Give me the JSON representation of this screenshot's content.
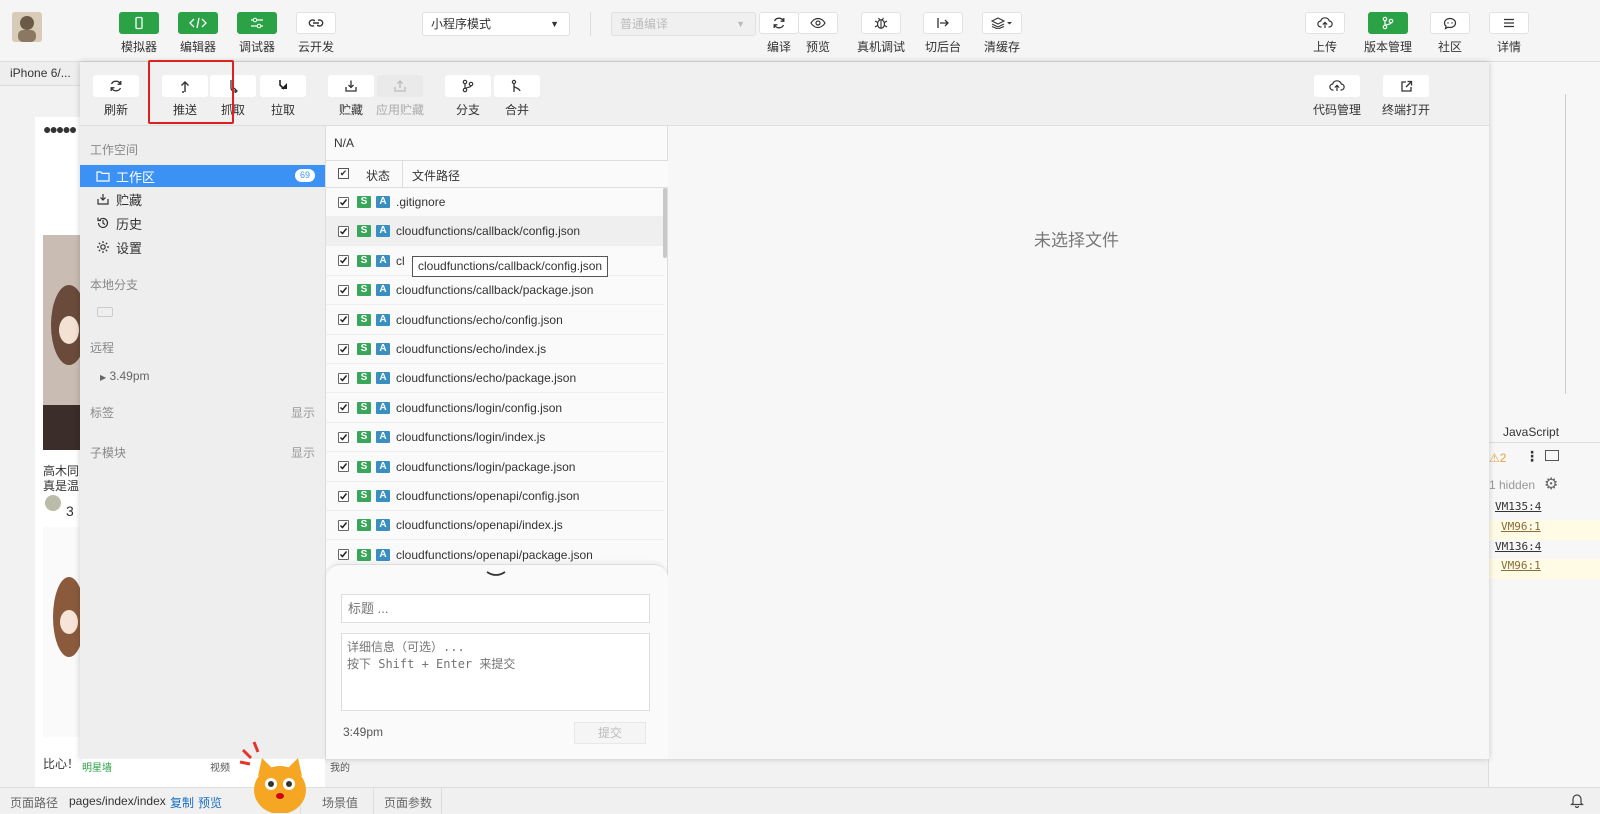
{
  "toolbar": {
    "left": [
      {
        "label": "模拟器",
        "icon": "phone-icon"
      },
      {
        "label": "编辑器",
        "icon": "code-icon"
      },
      {
        "label": "调试器",
        "icon": "sliders-icon"
      },
      {
        "label": "云开发",
        "icon": "cloud-link-icon"
      }
    ],
    "mode_select": "小程序模式",
    "compile_select": "普通编译",
    "mid": [
      {
        "label": "编译",
        "icon": "refresh-icon"
      },
      {
        "label": "预览",
        "icon": "eye-icon"
      },
      {
        "label": "真机调试",
        "icon": "bug-icon"
      },
      {
        "label": "切后台",
        "icon": "switch-icon"
      },
      {
        "label": "清缓存",
        "icon": "layers-icon"
      }
    ],
    "right": [
      {
        "label": "上传",
        "icon": "upload-cloud-icon"
      },
      {
        "label": "版本管理",
        "icon": "branch-icon"
      },
      {
        "label": "社区",
        "icon": "chat-icon"
      },
      {
        "label": "详情",
        "icon": "menu-icon"
      }
    ]
  },
  "device_label": "iPhone 6/...",
  "vcs": {
    "actions": [
      {
        "label": "刷新",
        "icon": "refresh-icon"
      },
      {
        "label": "推送",
        "icon": "push-icon"
      },
      {
        "label": "抓取",
        "icon": "fetch-icon"
      },
      {
        "label": "拉取",
        "icon": "pull-icon"
      },
      {
        "label": "贮藏",
        "icon": "stash-icon"
      },
      {
        "label": "应用贮藏",
        "icon": "apply-stash-icon"
      },
      {
        "label": "分支",
        "icon": "branch-icon"
      },
      {
        "label": "合并",
        "icon": "merge-icon"
      }
    ],
    "right_actions": [
      {
        "label": "代码管理",
        "icon": "cloud-code-icon"
      },
      {
        "label": "终端打开",
        "icon": "external-icon"
      }
    ],
    "sidebar": {
      "workspace_title": "工作空间",
      "items": [
        {
          "label": "工作区",
          "count": "69"
        },
        {
          "label": "贮藏"
        },
        {
          "label": "历史"
        },
        {
          "label": "设置"
        }
      ],
      "local_branch_title": "本地分支",
      "remote_title": "远程",
      "remote_item": "3.49pm",
      "tags_title": "标签",
      "tags_show": "显示",
      "submodule_title": "子模块",
      "submodule_show": "显示"
    },
    "files": {
      "branch": "N/A",
      "col_status": "状态",
      "col_path": "文件路径",
      "rows": [
        ".gitignore",
        "cloudfunctions/callback/config.json",
        "cl",
        "cloudfunctions/callback/package.json",
        "cloudfunctions/echo/config.json",
        "cloudfunctions/echo/index.js",
        "cloudfunctions/echo/package.json",
        "cloudfunctions/login/config.json",
        "cloudfunctions/login/index.js",
        "cloudfunctions/login/package.json",
        "cloudfunctions/openapi/config.json",
        "cloudfunctions/openapi/index.js",
        "cloudfunctions/openapi/package.json"
      ],
      "tooltip": "cloudfunctions/callback/config.json"
    },
    "commit": {
      "title_placeholder": "标题 ...",
      "detail_placeholder": "详细信息（可选）...\n按下 Shift + Enter 来提交",
      "time": "3:49pm",
      "submit": "提交"
    },
    "empty_text": "未选择文件"
  },
  "simulator_text": {
    "line1": "高木同",
    "line2": "真是温",
    "footer": "比心！",
    "count": "3"
  },
  "right_panel": {
    "lang": "JavaScript",
    "warn_count": "2",
    "hidden": "1 hidden",
    "links": [
      "VM135:4",
      "VM96:1",
      "VM136:4",
      "VM96:1"
    ]
  },
  "statusbar": {
    "path_label": "页面路径",
    "path": "pages/index/index",
    "copy": "复制",
    "preview": "预览",
    "scene": "场景值",
    "params": "页面参数",
    "tabs_bottom": [
      "明星墙",
      "视频",
      "我的"
    ]
  }
}
